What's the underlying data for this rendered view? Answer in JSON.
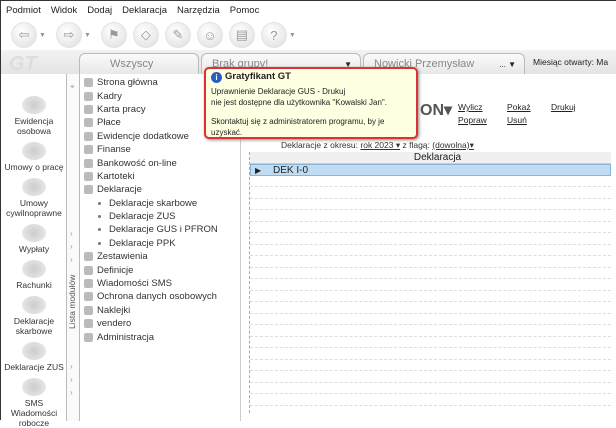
{
  "menu": [
    "Podmiot",
    "Widok",
    "Dodaj",
    "Deklaracja",
    "Narzędzia",
    "Pomoc"
  ],
  "logo": "GT",
  "tabs": {
    "all": "Wszyscy",
    "group": "Brak grupy!",
    "person": "Nowicki Przemysław",
    "person_more": "...",
    "month": "Miesiąc otwarty: Ma"
  },
  "leftbar": [
    "Ewidencja osobowa",
    "Umowy o pracę",
    "Umowy cywilnoprawne",
    "Wypłaty",
    "Rachunki",
    "Deklaracje skarbowe",
    "Deklaracje ZUS",
    "SMS Wiadomości robocze"
  ],
  "strip_label": "Lista modułów",
  "tree": [
    {
      "label": "Strona główna",
      "sub": false
    },
    {
      "label": "Kadry",
      "sub": false
    },
    {
      "label": "Karta pracy",
      "sub": false
    },
    {
      "label": "Płace",
      "sub": false
    },
    {
      "label": "Ewidencje dodatkowe",
      "sub": false
    },
    {
      "label": "Finanse",
      "sub": false
    },
    {
      "label": "Bankowość on-line",
      "sub": false
    },
    {
      "label": "Kartoteki",
      "sub": false
    },
    {
      "label": "Deklaracje",
      "sub": false
    },
    {
      "label": "Deklaracje skarbowe",
      "sub": true
    },
    {
      "label": "Deklaracje ZUS",
      "sub": true
    },
    {
      "label": "Deklaracje GUS i PFRON",
      "sub": true
    },
    {
      "label": "Deklaracje PPK",
      "sub": true
    },
    {
      "label": "Zestawienia",
      "sub": false
    },
    {
      "label": "Definicje",
      "sub": false
    },
    {
      "label": "Wiadomości SMS",
      "sub": false
    },
    {
      "label": "Ochrona danych osobowych",
      "sub": false
    },
    {
      "label": "Naklejki",
      "sub": false
    },
    {
      "label": "vendero",
      "sub": false
    },
    {
      "label": "Administracja",
      "sub": false
    }
  ],
  "main": {
    "header": "ON▾",
    "links": {
      "wylicz": "Wylicz",
      "popraw": "Popraw",
      "pokaz": "Pokaż",
      "usun": "Usuń",
      "drukuj": "Drukuj"
    },
    "filter": {
      "label": "Deklaracje z okresu:",
      "period": "rok 2023 ▾",
      "flag_label": "z flagą:",
      "flag": "(dowolna)▾"
    },
    "grid": {
      "column": "Deklaracja",
      "rows": [
        "DEK I-0"
      ]
    }
  },
  "tooltip": {
    "title": "Gratyfikant GT",
    "line1": "Uprawnienie Deklaracje GUS - Drukuj",
    "line2": "nie jest dostępne dla użytkownika \"Kowalski Jan\".",
    "line3": "Skontaktuj się z administratorem programu, by je uzyskać."
  },
  "colors": {
    "tooltip_border": "#e03030",
    "tooltip_bg": "#ffffe1",
    "selection": "#bfdcf3"
  }
}
